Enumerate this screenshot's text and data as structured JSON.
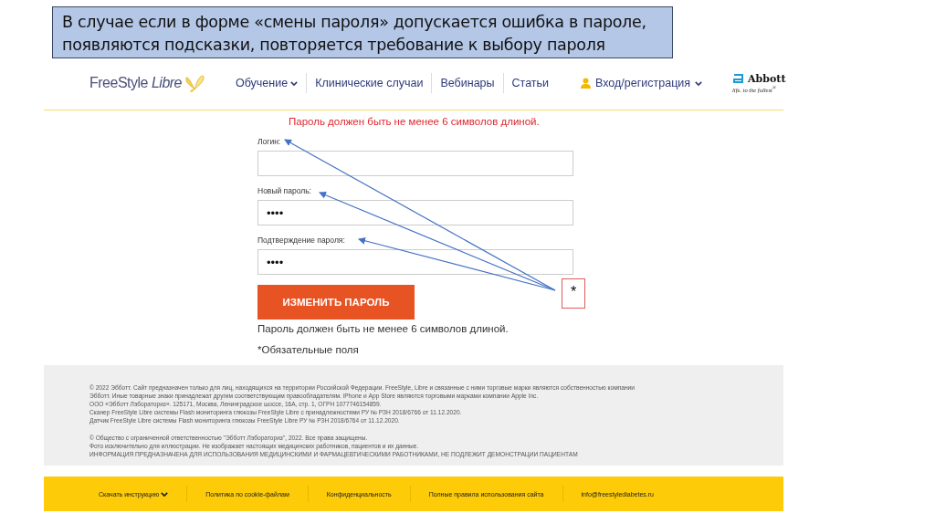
{
  "callout": {
    "text": "В случае если  в форме  «смены пароля» допускается ошибка в пароле, появляются подсказки, повторяется требование к выбору пароля"
  },
  "header": {
    "logo": "FreeStyle *Libre*",
    "nav": [
      {
        "label": "Обучение",
        "dropdown": true
      },
      {
        "label": "Клинические случаи",
        "dropdown": false
      },
      {
        "label": "Вебинары",
        "dropdown": false
      },
      {
        "label": "Статьи",
        "dropdown": false
      }
    ],
    "login": {
      "label": "Вход/регистрация",
      "dropdown": true
    },
    "abbott": {
      "name": "Abbott",
      "slogan": "life. to the fullest$^{®}$"
    }
  },
  "form": {
    "error": "Пароль должен быть не менее 6 символов длиной.",
    "fields": [
      {
        "label": "Логин:"
      },
      {
        "label": "Новый пароль:",
        "value": "••••"
      },
      {
        "label": "Подтверждение пароля:",
        "value": "••••"
      }
    ],
    "button": "ИЗМЕНИТЬ ПАРОЛЬ",
    "hint": "Пароль должен быть не менее 6 символов длиной.",
    "required": "*Обязательные поля"
  },
  "annotation": {
    "mark": "*"
  },
  "footer": {
    "paragraphs": [
      [
        "© 2022 Эбботт. Сайт предназначен только для лиц, находящихся на территории Российской Федерации. FreeStyle, Libre и связанные с ними торговые марки являются собственностью компании",
        "Эбботт. Иные товарные знаки принадлежат другим соответствующим правообладателям. iPhone и App Store являются торговыми марками компании Apple Inc.",
        "ООО «Эбботт Лэбораториз». 125171, Москва, Ленинградское шоссе, 16А, стр. 1, ОГРН 1077746154859.",
        "Сканер FreeStyle Libre системы Flash мониторинга глюкозы FreeStyle Libre с принадлежностями РУ № РЗН 2018/6766 от 11.12.2020.",
        "Датчик FreeStyle Libre системы Flash мониторинга глюкозы FreeStyle Libre РУ № РЗН 2018/6764 от 11.12.2020."
      ],
      [
        "© Общество с ограниченной ответственностью \"Эбботт Лэбораториз\", 2022. Все права защищены.",
        "Фото исключительно для иллюстрации. Не изображает настоящих медицинских работников, пациентов и их данные.",
        "ИНФОРМАЦИЯ ПРЕДНАЗНАЧЕНА ДЛЯ ИСПОЛЬЗОВАНИЯ МЕДИЦИНСКИМИ И ФАРМАЦЕВТИЧЕСКИМИ РАБОТНИКАМИ, НЕ ПОДЛЕЖИТ ДЕМОНСТРАЦИИ ПАЦИЕНТАМ"
      ]
    ],
    "links": [
      {
        "label": "Скачать инструкцию",
        "dropdown": true
      },
      {
        "label": "Политика по cookie-файлам",
        "dropdown": false
      },
      {
        "label": "Конфиденциальность",
        "dropdown": false
      },
      {
        "label": "Полные правила использования сайта",
        "dropdown": false
      },
      {
        "label": "info@freestylediabetes.ru",
        "dropdown": false
      }
    ]
  }
}
